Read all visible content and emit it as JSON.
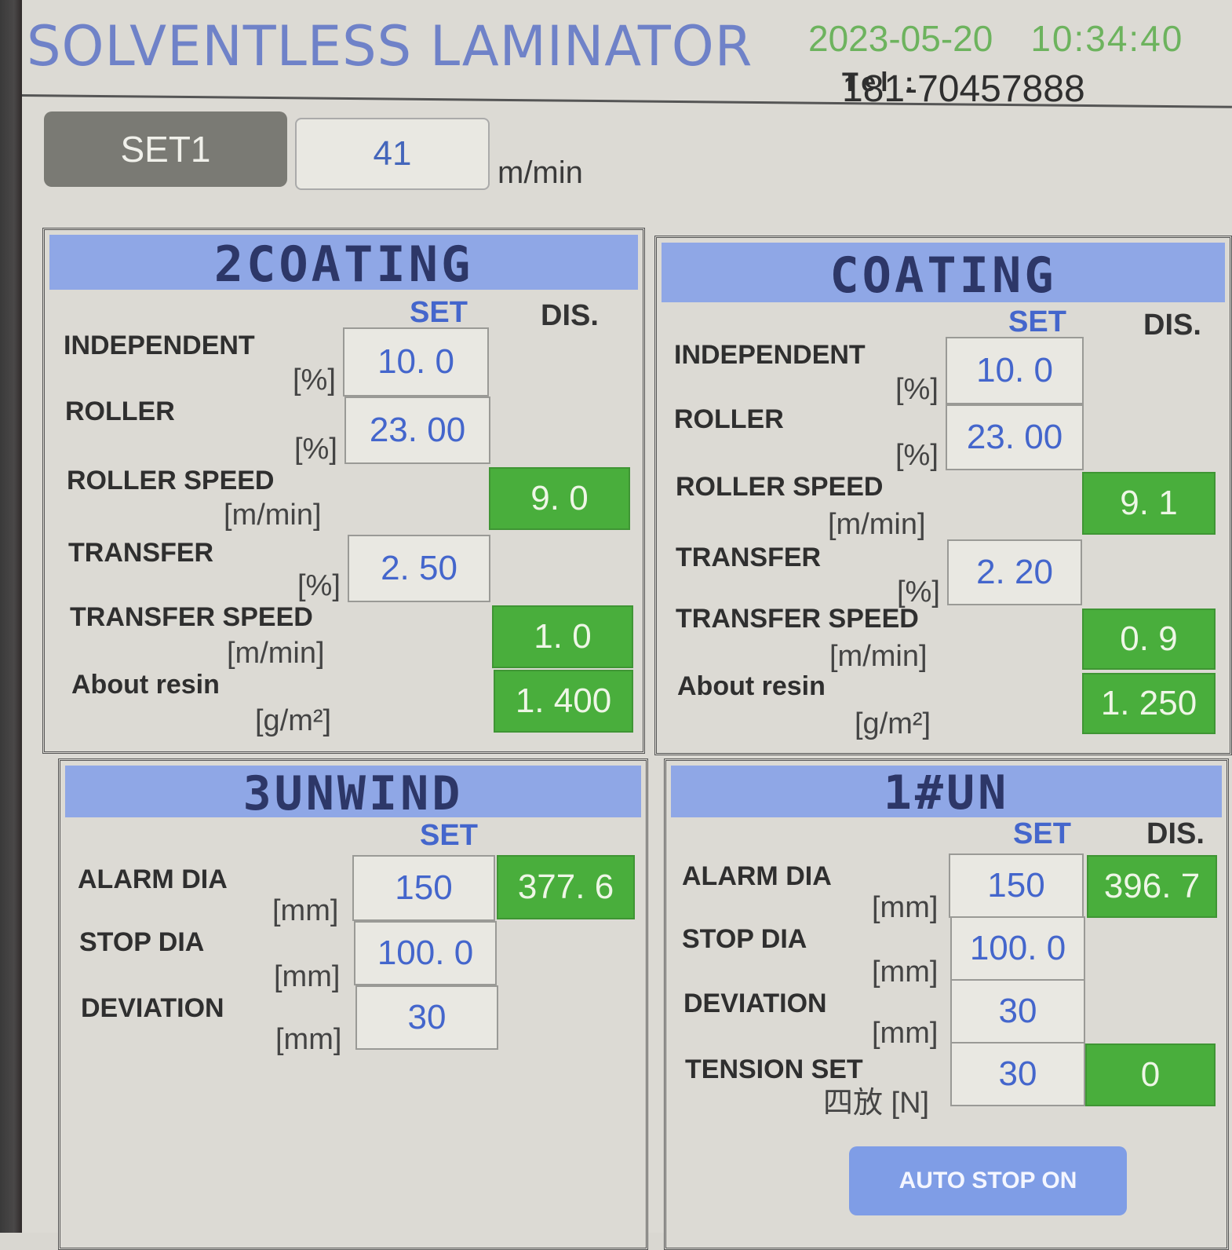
{
  "header": {
    "title": "SOLVENTLESS LAMINATOR",
    "date": "2023-05-20",
    "time": "10:34:40",
    "tel_label": "Tel :",
    "tel_number": "181-70457888"
  },
  "speed": {
    "set_button": "SET1",
    "value": "41",
    "unit": "m/min"
  },
  "colors": {
    "header_bar": "#8fa7e6",
    "display_green": "#49ae3c",
    "set_text_blue": "#4466cc",
    "datetime_green": "#6db35e"
  },
  "panels": {
    "coating2": {
      "title": "2COATING",
      "set_header": "SET",
      "dis_header": "DIS.",
      "rows": [
        {
          "label": "INDEPENDENT",
          "unit": "[%]",
          "set": "10. 0"
        },
        {
          "label": "ROLLER",
          "unit": "[%]",
          "set": "23. 00"
        },
        {
          "label": "ROLLER SPEED",
          "unit": "[m/min]",
          "dis": "9. 0"
        },
        {
          "label": "TRANSFER",
          "unit": "[%]",
          "set": "2. 50"
        },
        {
          "label": "TRANSFER SPEED",
          "unit": "[m/min]",
          "dis": "1. 0"
        },
        {
          "label": "About resin",
          "unit": "[g/m²]",
          "dis": "1. 400"
        }
      ]
    },
    "coating": {
      "title": "COATING",
      "set_header": "SET",
      "dis_header": "DIS.",
      "rows": [
        {
          "label": "INDEPENDENT",
          "unit": "[%]",
          "set": "10. 0"
        },
        {
          "label": "ROLLER",
          "unit": "[%]",
          "set": "23. 00"
        },
        {
          "label": "ROLLER SPEED",
          "unit": "[m/min]",
          "dis": "9. 1"
        },
        {
          "label": "TRANSFER",
          "unit": "[%]",
          "set": "2. 20"
        },
        {
          "label": "TRANSFER SPEED",
          "unit": "[m/min]",
          "dis": "0. 9"
        },
        {
          "label": "About resin",
          "unit": "[g/m²]",
          "dis": "1. 250"
        }
      ]
    },
    "unwind3": {
      "title": "3UNWIND",
      "set_header": "SET",
      "rows": [
        {
          "label": "ALARM DIA",
          "unit": "[mm]",
          "set": "150",
          "dis": "377. 6"
        },
        {
          "label": "STOP DIA",
          "unit": "[mm]",
          "set": "100. 0"
        },
        {
          "label": "DEVIATION",
          "unit": "[mm]",
          "set": "30"
        }
      ]
    },
    "unwind1": {
      "title": "1#UN",
      "set_header": "SET",
      "dis_header": "DIS.",
      "rows": [
        {
          "label": "ALARM DIA",
          "unit": "[mm]",
          "set": "150",
          "dis": "396. 7"
        },
        {
          "label": "STOP DIA",
          "unit": "[mm]",
          "set": "100. 0"
        },
        {
          "label": "DEVIATION",
          "unit": "[mm]",
          "set": "30"
        },
        {
          "label": "TENSION SET",
          "unit": "四放 [N]",
          "set": "30",
          "dis": "0"
        }
      ],
      "auto_stop_button": "AUTO STOP ON"
    }
  }
}
